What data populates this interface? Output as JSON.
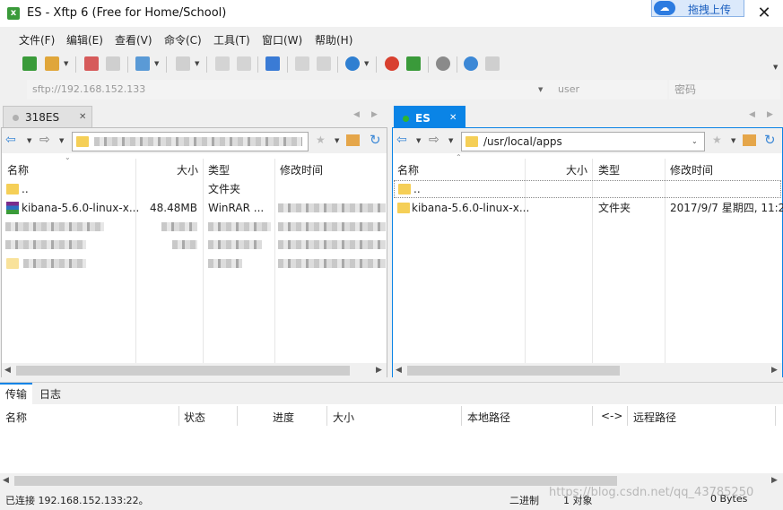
{
  "window": {
    "app_icon": "xftp-icon",
    "title": "ES - Xftp 6 (Free for Home/School)",
    "cloud_button": "拖拽上传",
    "close": "✕"
  },
  "menu": [
    "文件(F)",
    "编辑(E)",
    "查看(V)",
    "命令(C)",
    "工具(T)",
    "窗口(W)",
    "帮助(H)"
  ],
  "toolbar_icons": [
    "new-session-icon",
    "open-folder-icon",
    "disconnect-icon",
    "reconnect-icon",
    "new-tab-icon",
    "transfer-icon",
    "doc-icon",
    "doc2-icon",
    "sync-icon",
    "copy-icon",
    "paste-icon",
    "globe-icon",
    "snail-icon",
    "xshell-icon",
    "settings-icon",
    "help-icon",
    "chat-icon"
  ],
  "address": {
    "host_placeholder": "sftp://192.168.152.133",
    "user_placeholder": "user",
    "password_placeholder": "密码"
  },
  "left": {
    "tab": "318ES",
    "tab_close": "✕",
    "columns": [
      "名称",
      "大小",
      "类型",
      "修改时间"
    ],
    "rows": [
      {
        "name": "..",
        "size": "",
        "type": "文件夹",
        "mtime": ""
      },
      {
        "name": "kibana-5.6.0-linux-x...",
        "size": "48.48MB",
        "type": "WinRAR ...",
        "mtime": ""
      }
    ]
  },
  "right": {
    "tab": "ES",
    "tab_close": "✕",
    "path": "/usr/local/apps",
    "columns": [
      "名称",
      "大小",
      "类型",
      "修改时间"
    ],
    "rows": [
      {
        "name": "..",
        "size": "",
        "type": "",
        "mtime": ""
      },
      {
        "name": "kibana-5.6.0-linux-x...",
        "size": "",
        "type": "文件夹",
        "mtime": "2017/9/7 星期四, 11:2"
      }
    ]
  },
  "bottom": {
    "tabs": [
      "传输",
      "日志"
    ],
    "columns": [
      "名称",
      "状态",
      "进度",
      "大小",
      "本地路径",
      "<->",
      "远程路径"
    ]
  },
  "status": {
    "connection": "已连接 192.168.152.133:22。",
    "mode": "二进制",
    "objects": "1 对象",
    "size": "0 Bytes",
    "watermark": "https://blog.csdn.net/qq_43785250"
  },
  "colors": {
    "accent": "#0078d7",
    "folder": "#f5cf57",
    "active_dot": "#2fb52f"
  }
}
